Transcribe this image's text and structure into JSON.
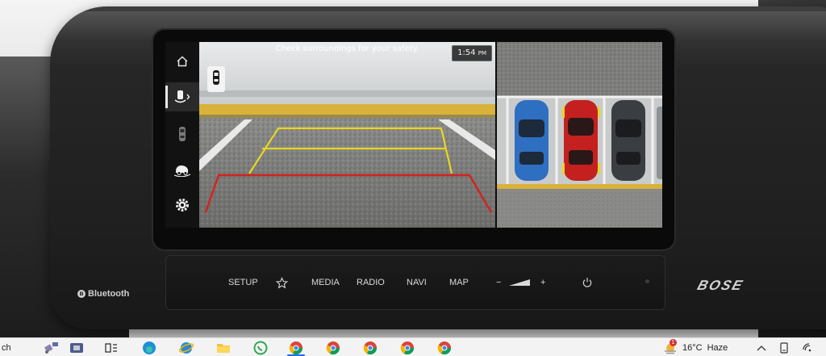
{
  "screen": {
    "banner_text": "Check surroundings for your safety.",
    "clock_time": "1:54",
    "clock_suffix": "PM"
  },
  "sidebar": {
    "items": [
      {
        "icon": "home-icon",
        "active": false
      },
      {
        "icon": "parking-sensor-icon",
        "active": true
      },
      {
        "icon": "car-top-icon",
        "active": false
      },
      {
        "icon": "car-3d-view-icon",
        "active": false
      },
      {
        "icon": "settings-gear-icon",
        "active": false
      }
    ]
  },
  "controls": {
    "setup": "SETUP",
    "media": "MEDIA",
    "radio": "RADIO",
    "navi": "NAVI",
    "map": "MAP",
    "volume_minus": "−",
    "volume_plus": "+"
  },
  "hardware": {
    "bluetooth_label": "Bluetooth",
    "brand_logo": "BOSE"
  },
  "colors": {
    "guideline_red": "#d4221e",
    "guideline_yellow": "#e7d624",
    "car_blue": "#2f6fc2",
    "car_red": "#c42020",
    "car_dark": "#3a3d42"
  },
  "taskbar": {
    "search_fragment": "ch",
    "weather_temp": "16°C",
    "weather_desc": "Haze",
    "notification_count": "1"
  }
}
